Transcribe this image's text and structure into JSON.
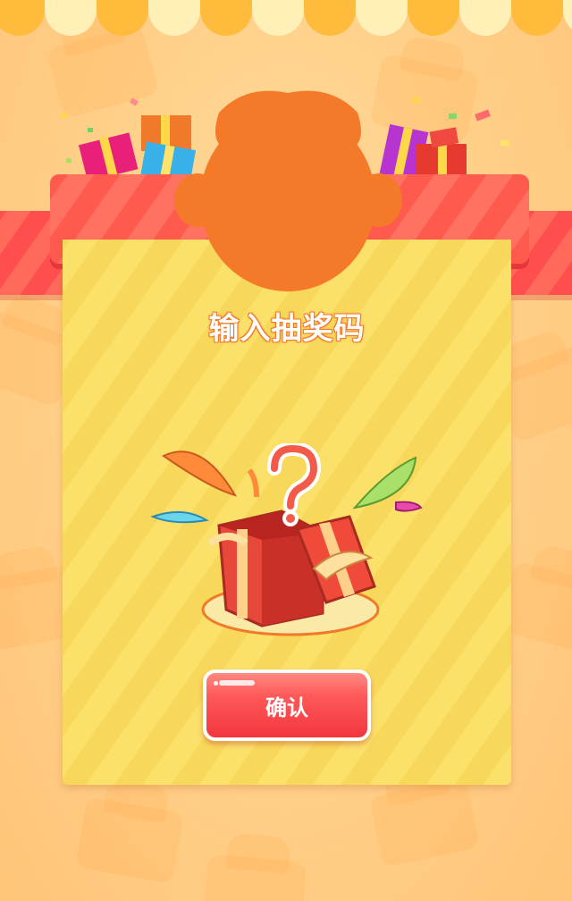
{
  "dialog": {
    "title": "输入抽奖码",
    "confirm_label": "确认"
  },
  "colors": {
    "background": "#ffcf88",
    "ribbon_red": "#ff4e4e",
    "card_yellow": "#fbe06a",
    "avatar_orange": "#f47a2a",
    "button_red": "#f2363e"
  },
  "icons": {
    "mystery_box": "mystery-gift-box-icon",
    "avatar": "mascot-silhouette-icon"
  }
}
